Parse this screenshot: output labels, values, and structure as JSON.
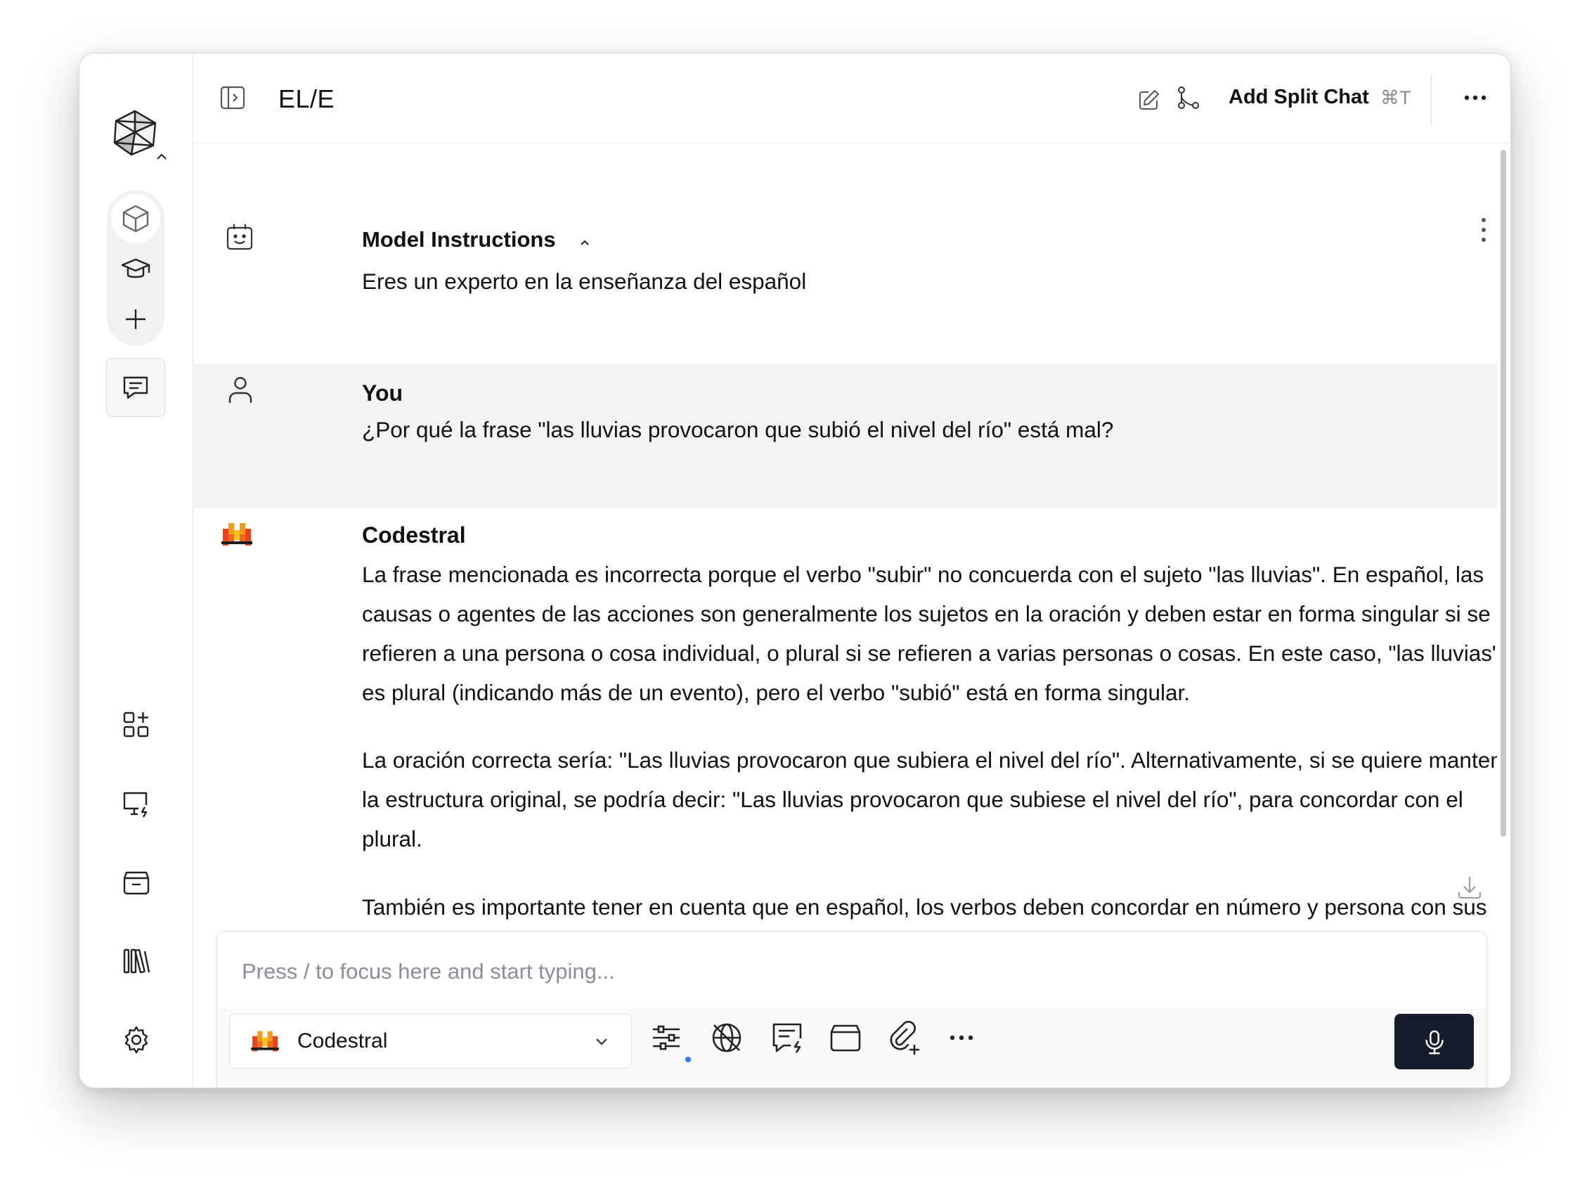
{
  "window": {
    "title": "EL/E"
  },
  "topbar": {
    "add_split_chat_label": "Add Split Chat",
    "add_split_chat_shortcut": "⌘T"
  },
  "model_instructions": {
    "heading": "Model Instructions",
    "text": "Eres un experto en la enseñanza del español"
  },
  "messages": [
    {
      "author": "You",
      "paragraphs": [
        "¿Por qué la frase \"las lluvias provocaron que subió el nivel del río\" está mal?"
      ]
    },
    {
      "author": "Codestral",
      "paragraphs": [
        "La frase mencionada es incorrecta porque el verbo \"subir\" no concuerda con el sujeto \"las lluvias\". En español, las causas o agentes de las acciones son generalmente los sujetos en la oración y deben estar en forma singular si se refieren a una persona o cosa individual, o plural si se refieren a varias personas o cosas. En este caso, \"las lluvias\" es plural (indicando más de un evento), pero el verbo \"subió\" está en forma singular.",
        "La oración correcta sería: \"Las lluvias provocaron que subiera el nivel del río\". Alternativamente, si se quiere mantener la estructura original, se podría decir: \"Las lluvias provocaron que subiese el nivel del río\", para concordar con el plural.",
        "También es importante tener en cuenta que en español, los verbos deben concordar en número y persona con sus sujetos. Por lo tanto, cuando el sujeto es plural, el verbo generalmente se pone en plural o en forma"
      ]
    }
  ],
  "composer": {
    "placeholder": "Press / to focus here and start typing...",
    "selected_model": "Codestral"
  },
  "colors": {
    "mic_button": "#161c2c",
    "you_block_bg": "#f3f3f3",
    "badge_dot": "#2f7cf6"
  },
  "icons": {
    "sidebar": [
      "app-logo-icon",
      "cube-icon",
      "graduation-cap-icon",
      "plus-icon",
      "chat-bubble-icon",
      "apps-add-icon",
      "monitor-bolt-icon",
      "archive-icon",
      "library-icon",
      "settings-icon"
    ],
    "topbar": [
      "sidebar-toggle-icon",
      "edit-icon",
      "branch-icon",
      "more-horizontal-icon"
    ],
    "composer": [
      "sliders-icon",
      "web-off-icon",
      "chat-bolt-icon",
      "archive-icon",
      "attach-plus-icon",
      "more-horizontal-icon",
      "microphone-icon"
    ]
  }
}
